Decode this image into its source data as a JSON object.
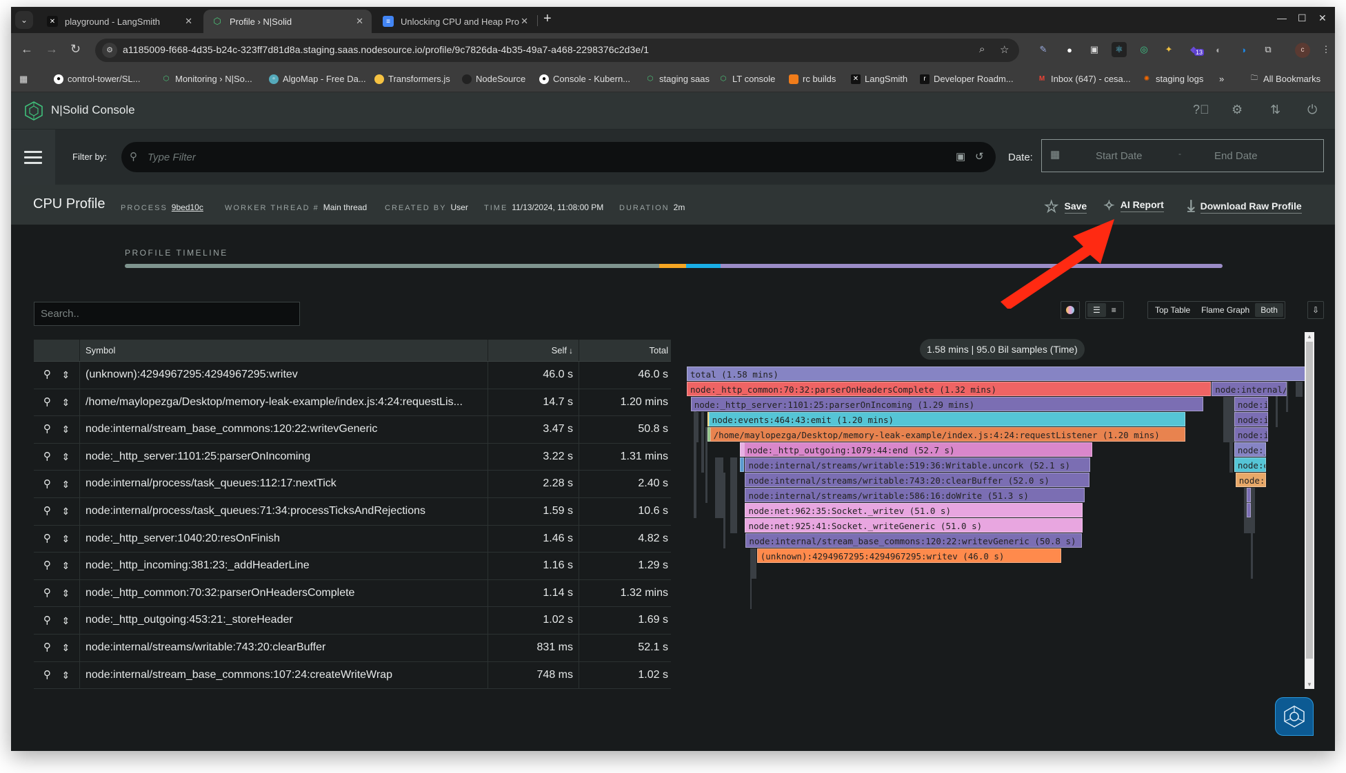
{
  "browser": {
    "tabs": [
      {
        "title": "playground - LangSmith",
        "icon": "langsmith-icon",
        "active": false
      },
      {
        "title": "Profile › N|Solid",
        "icon": "nsolid-icon",
        "active": true
      },
      {
        "title": "Unlocking CPU and Heap Pro",
        "icon": "docs-icon",
        "active": false
      }
    ],
    "url": "a1185009-f668-4d35-b24c-323ff7d81d8a.staging.saas.nodesource.io/profile/9c7826da-4b35-49a7-a468-2298376c2d3e/1",
    "extension_badge": "13",
    "profile_initial": "c",
    "bookmarks": [
      {
        "label": "control-tower/SL...",
        "icon": "github-icon"
      },
      {
        "label": "Monitoring › N|So...",
        "icon": "nsolid-icon"
      },
      {
        "label": "AlgoMap - Free Da...",
        "icon": "algomap-icon"
      },
      {
        "label": "Transformers.js",
        "icon": "huggingface-icon"
      },
      {
        "label": "NodeSource",
        "icon": "github-icon"
      },
      {
        "label": "Console - Kubern...",
        "icon": "github-icon"
      },
      {
        "label": "staging saas",
        "icon": "nsolid-icon"
      },
      {
        "label": "LT console",
        "icon": "nsolid-icon"
      },
      {
        "label": "rc builds",
        "icon": "box-icon"
      },
      {
        "label": "LangSmith",
        "icon": "langsmith-icon"
      },
      {
        "label": "Developer Roadm...",
        "icon": "roadmap-icon"
      },
      {
        "label": "Inbox (647) - cesa...",
        "icon": "gmail-icon"
      },
      {
        "label": "staging logs",
        "icon": "grafana-icon"
      }
    ],
    "more_bookmarks": "»",
    "all_bookmarks": "All Bookmarks"
  },
  "app": {
    "name": "N|Solid Console",
    "filter_label": "Filter by:",
    "filter_placeholder": "Type Filter",
    "date_label": "Date:",
    "start_date_placeholder": "Start Date",
    "end_date_placeholder": "End Date"
  },
  "profile": {
    "title": "CPU Profile",
    "meta": [
      {
        "key": "PROCESS",
        "value": "9bed10c",
        "link": true
      },
      {
        "key": "WORKER THREAD #",
        "value": "Main thread",
        "link": false
      },
      {
        "key": "CREATED BY",
        "value": "User",
        "link": false
      },
      {
        "key": "TIME",
        "value": "11/13/2024, 11:08:00 PM",
        "link": false
      },
      {
        "key": "DURATION",
        "value": "2m",
        "link": false
      }
    ],
    "actions": {
      "save": "Save",
      "ai_report": "AI Report",
      "download": "Download Raw Profile"
    },
    "timeline_label": "PROFILE TIMELINE",
    "timeline_segments": [
      {
        "fraction": 0.487,
        "color": "#7e948e"
      },
      {
        "fraction": 0.024,
        "color": "#f5a623"
      },
      {
        "fraction": 0.032,
        "color": "#1aaee6"
      },
      {
        "fraction": 0.457,
        "color": "#9b8cc6"
      }
    ]
  },
  "search_placeholder": "Search..",
  "view_controls": {
    "color_toggle": "color-mode-icon",
    "align_left": "align-left-icon",
    "align_right": "align-right-icon",
    "views": [
      "Top Table",
      "Flame Graph",
      "Both"
    ],
    "selected_view": "Both",
    "export": "export-icon"
  },
  "table": {
    "columns": {
      "symbol": "Symbol",
      "self": "Self",
      "total": "Total"
    },
    "sort": "self-desc",
    "rows": [
      {
        "symbol": "(unknown):4294967295:4294967295:writev",
        "self": "46.0 s",
        "total": "46.0 s"
      },
      {
        "symbol": "/home/maylopezga/Desktop/memory-leak-example/index.js:4:24:requestLis...",
        "self": "14.7 s",
        "total": "1.20 mins"
      },
      {
        "symbol": "node:internal/stream_base_commons:120:22:writevGeneric",
        "self": "3.47 s",
        "total": "50.8 s"
      },
      {
        "symbol": "node:_http_server:1101:25:parserOnIncoming",
        "self": "3.22 s",
        "total": "1.31 mins"
      },
      {
        "symbol": "node:internal/process/task_queues:112:17:nextTick",
        "self": "2.28 s",
        "total": "2.40 s"
      },
      {
        "symbol": "node:internal/process/task_queues:71:34:processTicksAndRejections",
        "self": "1.59 s",
        "total": "10.6 s"
      },
      {
        "symbol": "node:_http_server:1040:20:resOnFinish",
        "self": "1.46 s",
        "total": "4.82 s"
      },
      {
        "symbol": "node:_http_incoming:381:23:_addHeaderLine",
        "self": "1.16 s",
        "total": "1.29 s"
      },
      {
        "symbol": "node:_http_common:70:32:parserOnHeadersComplete",
        "self": "1.14 s",
        "total": "1.32 mins"
      },
      {
        "symbol": "node:_http_outgoing:453:21:_storeHeader",
        "self": "1.02 s",
        "total": "1.69 s"
      },
      {
        "symbol": "node:internal/streams/writable:743:20:clearBuffer",
        "self": "831 ms",
        "total": "52.1 s"
      },
      {
        "symbol": "node:internal/stream_base_commons:107:24:createWriteWrap",
        "self": "748 ms",
        "total": "1.02 s"
      }
    ]
  },
  "flame": {
    "summary": "1.58 mins | 95.0 Bil samples (Time)",
    "total_seconds": 94.8,
    "frames": [
      {
        "label": "total (1.58 mins)",
        "depth": 0,
        "start": 0.0,
        "seconds": 94.8,
        "color": "#8684c4"
      },
      {
        "label": "node:_http_common:70:32:parserOnHeadersComplete (1.32 mins)",
        "depth": 1,
        "start": 0.0,
        "seconds": 79.2,
        "color": "#ef6464"
      },
      {
        "label": "node:internal/streams/...",
        "depth": 1,
        "start": 79.3,
        "seconds": 11.3,
        "color": "#7b6eb3"
      },
      {
        "label": "node:_http_server:1101:25:parserOnIncoming (1.29 mins)",
        "depth": 2,
        "start": 0.6,
        "seconds": 77.4,
        "color": "#7b6eb3"
      },
      {
        "label": "node:internal...",
        "depth": 2,
        "start": 82.7,
        "seconds": 5.1,
        "color": "#7b6eb3"
      },
      {
        "label": "node:events:464:43:emit (1.20 mins)",
        "depth": 3,
        "start": 3.3,
        "seconds": 72.0,
        "color": "#55c5d6"
      },
      {
        "label": "node:internal...",
        "depth": 3,
        "start": 82.7,
        "seconds": 5.1,
        "color": "#7b6eb3"
      },
      {
        "label": "/home/maylopezga/Desktop/memory-leak-example/index.js:4:24:requestListener (1.20 mins)",
        "depth": 4,
        "start": 3.5,
        "seconds": 71.8,
        "color": "#e8834f"
      },
      {
        "label": "node:internal...",
        "depth": 4,
        "start": 82.7,
        "seconds": 5.1,
        "color": "#7b6eb3"
      },
      {
        "label": "node:_http_outgoing:1079:44:end (52.7 s)",
        "depth": 5,
        "start": 8.6,
        "seconds": 52.7,
        "color": "#d987cb"
      },
      {
        "label": "node:_...",
        "depth": 5,
        "start": 82.7,
        "seconds": 4.8,
        "color": "#8684c4"
      },
      {
        "label": "node:internal/streams/writable:519:36:Writable.uncork (52.1 s)",
        "depth": 6,
        "start": 8.8,
        "seconds": 52.1,
        "color": "#7b6eb3"
      },
      {
        "label": "node:e...",
        "depth": 6,
        "start": 82.7,
        "seconds": 4.8,
        "color": "#55c5d6"
      },
      {
        "label": "node:internal/streams/writable:743:20:clearBuffer (52.0 s)",
        "depth": 7,
        "start": 8.8,
        "seconds": 52.0,
        "color": "#7b6eb3"
      },
      {
        "label": "node:...",
        "depth": 7,
        "start": 82.9,
        "seconds": 4.6,
        "color": "#e8a868"
      },
      {
        "label": "node:internal/streams/writable:586:16:doWrite (51.3 s)",
        "depth": 8,
        "start": 8.8,
        "seconds": 51.3,
        "color": "#7b6eb3"
      },
      {
        "label": "node:net:962:35:Socket._writev (51.0 s)",
        "depth": 9,
        "start": 8.8,
        "seconds": 51.0,
        "color": "#e8a6e0"
      },
      {
        "label": "node:net:925:41:Socket._writeGeneric (51.0 s)",
        "depth": 10,
        "start": 8.8,
        "seconds": 51.0,
        "color": "#e8a6e0"
      },
      {
        "label": "node:internal/stream_base_commons:120:22:writevGeneric (50.8 s)",
        "depth": 11,
        "start": 8.9,
        "seconds": 50.8,
        "color": "#7b6eb3"
      },
      {
        "label": "(unknown):4294967295:4294967295:writev (46.0 s)",
        "depth": 12,
        "start": 10.6,
        "seconds": 46.0,
        "color": "#ff8a4c"
      }
    ]
  }
}
